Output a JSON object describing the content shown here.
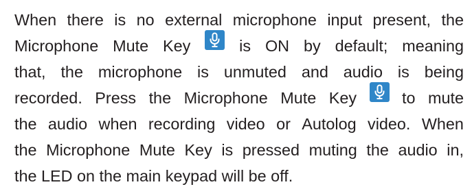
{
  "doc": {
    "icon_name": "microphone-icon",
    "icon_color": "#2f86c8",
    "lines": [
      [
        "When",
        "there",
        "is",
        "no",
        "external",
        "microphone",
        "input",
        "present,",
        "the"
      ],
      [
        "Microphone",
        "Mute",
        "Key"
      ],
      [
        "is",
        "ON",
        "by",
        "default;",
        "meaning"
      ],
      [
        "that,",
        "the",
        "microphone",
        "is",
        "unmuted",
        "and",
        "audio",
        "is",
        "being"
      ],
      [
        "recorded.",
        "Press",
        "the",
        "Microphone",
        "Mute",
        "Key"
      ],
      [
        "to",
        "mute"
      ],
      [
        "the",
        "audio",
        "when",
        "recording",
        "video",
        "or",
        "Autolog",
        "video.",
        "When"
      ],
      [
        "the",
        "Microphone",
        "Mute",
        "Key",
        "is",
        "pressed",
        "muting",
        "the",
        "audio",
        "in,"
      ],
      "the LED on the main keypad will be off."
    ]
  }
}
